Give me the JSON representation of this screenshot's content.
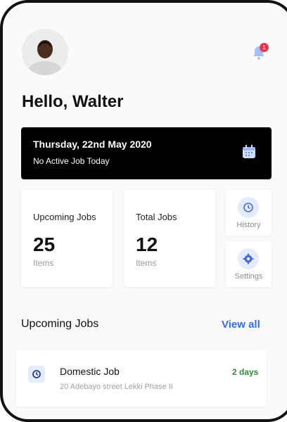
{
  "header": {
    "greeting": "Hello, Walter",
    "notification_count": "1"
  },
  "today": {
    "date": "Thursday, 22nd May 2020",
    "status": "No Active Job Today"
  },
  "stats": {
    "upcoming": {
      "label": "Upcoming Jobs",
      "value": "25",
      "unit": "Items"
    },
    "total": {
      "label": "Total Jobs",
      "value": "12",
      "unit": "Items"
    }
  },
  "quick_actions": {
    "history": "History",
    "settings": "Settings"
  },
  "upcoming_section": {
    "title": "Upcoming Jobs",
    "view_all": "View all"
  },
  "jobs": [
    {
      "title": "Domestic Job",
      "time_left": "2 days",
      "address": "20 Adebayo street Lekki Phase II"
    }
  ],
  "colors": {
    "accent_blue": "#2f6ee0",
    "badge_red": "#e8344d",
    "success_green": "#2f8b3f",
    "dark_card": "#000000"
  },
  "icons": [
    "bell-icon",
    "calendar-icon",
    "clock-icon",
    "gear-icon"
  ]
}
